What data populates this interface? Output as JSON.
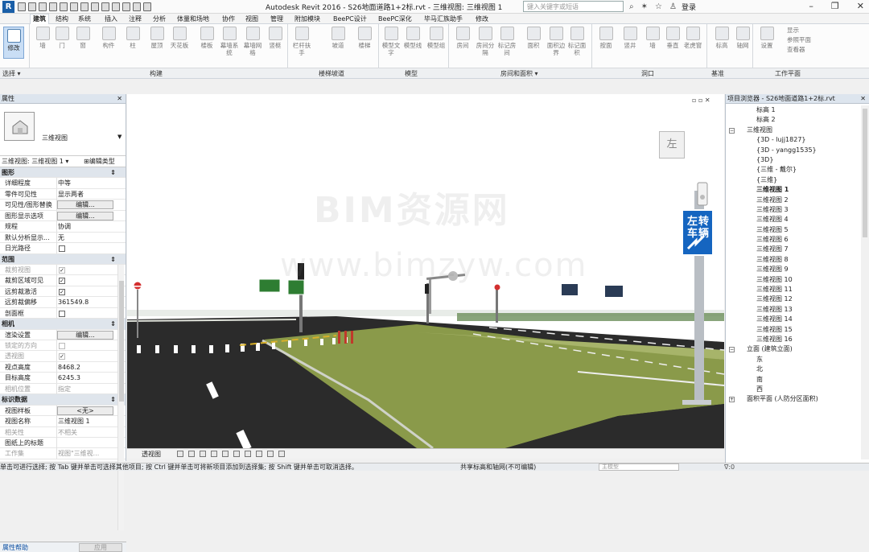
{
  "app": {
    "title": "Autodesk Revit 2016 -     S26地面道路1+2标.rvt - 三维视图: 三维视图 1",
    "search_placeholder": "键入关键字或短语",
    "login": "登录",
    "help": "?"
  },
  "tabs": [
    "建筑",
    "结构",
    "系统",
    "插入",
    "注释",
    "分析",
    "体量和场地",
    "协作",
    "视图",
    "管理",
    "附加模块",
    "BeePC设计",
    "BeePC深化",
    "毕马汇族助手",
    "修改"
  ],
  "ribbon": {
    "buttons": [
      {
        "label": "修改"
      },
      {
        "label": "墙"
      },
      {
        "label": "门"
      },
      {
        "label": "窗"
      },
      {
        "label": "构件"
      },
      {
        "label": "柱"
      },
      {
        "label": "屋顶"
      },
      {
        "label": "天花板"
      },
      {
        "label": "楼板"
      },
      {
        "label": "幕墙系统"
      },
      {
        "label": "幕墙网格"
      },
      {
        "label": "竖梃"
      },
      {
        "label": "栏杆扶手"
      },
      {
        "label": "坡道"
      },
      {
        "label": "楼梯"
      },
      {
        "label": "模型文字"
      },
      {
        "label": "模型线"
      },
      {
        "label": "模型组"
      },
      {
        "label": "房间"
      },
      {
        "label": "房间分隔"
      },
      {
        "label": "标记房间"
      },
      {
        "label": "面积"
      },
      {
        "label": "面积边界"
      },
      {
        "label": "标记面积"
      },
      {
        "label": "按面"
      },
      {
        "label": "竖井"
      },
      {
        "label": "墙"
      },
      {
        "label": "垂直"
      },
      {
        "label": "老虎窗"
      },
      {
        "label": "标高"
      },
      {
        "label": "轴网"
      },
      {
        "label": "设置"
      },
      {
        "label": "显示"
      },
      {
        "label": "参照平面"
      },
      {
        "label": "查看器"
      }
    ],
    "groups": [
      "选择 ▾",
      "构建",
      "楼梯坡道",
      "模型",
      "房间和面积 ▾",
      "洞口",
      "基准",
      "工作平面"
    ]
  },
  "properties": {
    "header": "属性",
    "type_name": "三维视图",
    "selector": "三维视图: 三维视图 1",
    "edit_type": "编辑类型",
    "rows": [
      {
        "kind": "sec",
        "k": "图形",
        "t": "⇕"
      },
      {
        "kind": "val",
        "k": "详细程度",
        "v": "中等"
      },
      {
        "kind": "val",
        "k": "零件可见性",
        "v": "显示两者"
      },
      {
        "kind": "btn",
        "k": "可见性/图形替换",
        "v": "编辑..."
      },
      {
        "kind": "btn",
        "k": "图形显示选项",
        "v": "编辑..."
      },
      {
        "kind": "val",
        "k": "规程",
        "v": "协调"
      },
      {
        "kind": "val",
        "k": "默认分析显示...",
        "v": "无"
      },
      {
        "kind": "ck",
        "k": "日光路径",
        "v": ""
      },
      {
        "kind": "sec",
        "k": "范围",
        "t": "⇕"
      },
      {
        "kind": "ckd",
        "k": "裁剪视图",
        "v": "✓"
      },
      {
        "kind": "ck",
        "k": "裁剪区域可见",
        "v": "✓"
      },
      {
        "kind": "ck",
        "k": "远剪裁激活",
        "v": "✓"
      },
      {
        "kind": "val",
        "k": "远剪裁偏移",
        "v": "361549.8"
      },
      {
        "kind": "ck",
        "k": "剖面框",
        "v": ""
      },
      {
        "kind": "sec",
        "k": "相机",
        "t": "⇕"
      },
      {
        "kind": "btn",
        "k": "渲染设置",
        "v": "编辑..."
      },
      {
        "kind": "ckd",
        "k": "锁定的方向",
        "v": ""
      },
      {
        "kind": "ckd",
        "k": "透视图",
        "v": "✓"
      },
      {
        "kind": "val",
        "k": "视点高度",
        "v": "8468.2"
      },
      {
        "kind": "val",
        "k": "目标高度",
        "v": "6245.3"
      },
      {
        "kind": "dim",
        "k": "相机位置",
        "v": "指定"
      },
      {
        "kind": "sec",
        "k": "标识数据",
        "t": "⇕"
      },
      {
        "kind": "btn",
        "k": "视图样板",
        "v": "<无>"
      },
      {
        "kind": "val",
        "k": "视图名称",
        "v": "三维视图 1"
      },
      {
        "kind": "dim",
        "k": "相关性",
        "v": "不相关"
      },
      {
        "kind": "val",
        "k": "图纸上的标题",
        "v": ""
      },
      {
        "kind": "dim",
        "k": "工作集",
        "v": "视图\"三维视..."
      }
    ],
    "help": "属性帮助",
    "apply": "应用"
  },
  "viewport": {
    "watermark1": "BIM资源网",
    "watermark2": "www.bimzyw.com",
    "viewcube": "左",
    "sign_line1": "左转",
    "sign_line2": "车辆"
  },
  "view_control": {
    "label": "透视图"
  },
  "browser": {
    "header": "项目浏览器 - S26地面道路1+2标.rvt",
    "items": [
      {
        "lvl": 3,
        "t": "标高 1"
      },
      {
        "lvl": 3,
        "t": "标高 2"
      },
      {
        "lvl": 1,
        "t": "三维视图",
        "tg": "−"
      },
      {
        "lvl": 2,
        "t": "{3D - lujj1827}"
      },
      {
        "lvl": 2,
        "t": "{3D - yangg1535}"
      },
      {
        "lvl": 2,
        "t": "{3D}"
      },
      {
        "lvl": 2,
        "t": "{三维 - 戴尔}"
      },
      {
        "lvl": 2,
        "t": "{三维}"
      },
      {
        "lvl": 2,
        "t": "三维视图 1",
        "bold": true
      },
      {
        "lvl": 2,
        "t": "三维视图 2"
      },
      {
        "lvl": 2,
        "t": "三维视图 3"
      },
      {
        "lvl": 2,
        "t": "三维视图 4"
      },
      {
        "lvl": 2,
        "t": "三维视图 5"
      },
      {
        "lvl": 2,
        "t": "三维视图 6"
      },
      {
        "lvl": 2,
        "t": "三维视图 7"
      },
      {
        "lvl": 2,
        "t": "三维视图 8"
      },
      {
        "lvl": 2,
        "t": "三维视图 9"
      },
      {
        "lvl": 2,
        "t": "三维视图 10"
      },
      {
        "lvl": 2,
        "t": "三维视图 11"
      },
      {
        "lvl": 2,
        "t": "三维视图 12"
      },
      {
        "lvl": 2,
        "t": "三维视图 13"
      },
      {
        "lvl": 2,
        "t": "三维视图 14"
      },
      {
        "lvl": 2,
        "t": "三维视图 15"
      },
      {
        "lvl": 2,
        "t": "三维视图 16"
      },
      {
        "lvl": 1,
        "t": "立面 (建筑立面)",
        "tg": "−"
      },
      {
        "lvl": 2,
        "t": "东"
      },
      {
        "lvl": 2,
        "t": "北"
      },
      {
        "lvl": 2,
        "t": "南"
      },
      {
        "lvl": 2,
        "t": "西"
      },
      {
        "lvl": 1,
        "t": "面积平面 (人防分区面积)",
        "tg": "+"
      }
    ]
  },
  "status": {
    "text": "单击可进行选择; 按 Tab 键并单击可选择其他项目; 按 Ctrl 键并单击可将新项目添加到选择集; 按 Shift 键并单击可取消选择。",
    "sync": "共享标高和轴网(不可编辑)",
    "model": "主模型",
    "filter": "∇:0"
  },
  "colors": {
    "accent": "#1a5fa8",
    "panel": "#dde5ee",
    "sign_blue": "#1565c0",
    "grass": "#8a9a4a",
    "road": "#2b2b2b"
  }
}
